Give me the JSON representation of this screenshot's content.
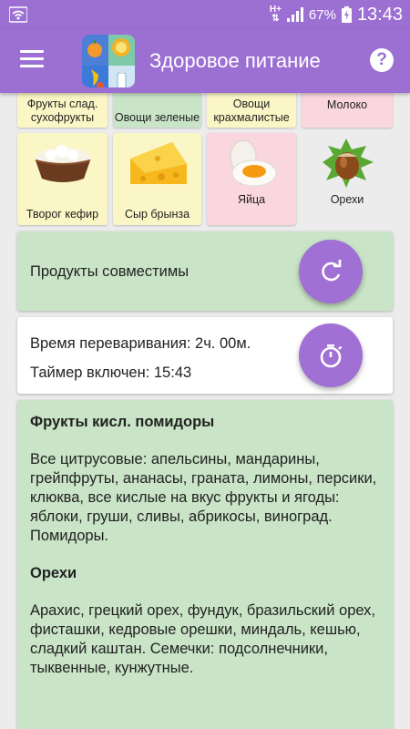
{
  "status_bar": {
    "network_type": "H+",
    "battery": "67%",
    "time": "13:43"
  },
  "app_bar": {
    "title": "Здоровое питание",
    "help_label": "?"
  },
  "categories_top": [
    {
      "label": "Фрукты слад. сухофрукты",
      "color": "#fbf6c5"
    },
    {
      "label": "Овощи зеленые",
      "color": "#c9e4c6"
    },
    {
      "label": "Овощи крахмалистые",
      "color": "#fbf6c5"
    },
    {
      "label": "Молоко",
      "color": "#fad6de"
    }
  ],
  "categories_bottom": [
    {
      "label": "Творог кефир",
      "icon": "cottage-cheese-icon",
      "color": "#fbf6c5"
    },
    {
      "label": "Сыр брынза",
      "icon": "cheese-icon",
      "color": "#fbf6c5"
    },
    {
      "label": "Яйца",
      "icon": "eggs-icon",
      "color": "#fad6de"
    },
    {
      "label": "Орехи",
      "icon": "hazelnut-icon",
      "color": "#ececec"
    }
  ],
  "compat_card": {
    "text": "Продукты совместимы",
    "button_icon": "refresh-icon"
  },
  "timer_card": {
    "digest_time": "Время переваривания: 2ч. 00м.",
    "timer_status": "Таймер включен: 15:43",
    "button_icon": "stopwatch-icon"
  },
  "info": {
    "section1_title": "Фрукты кисл. помидоры",
    "section1_body": "Все цитрусовые: апельсины, мандарины, грейпфруты, ананасы, граната, лимоны, персики, клюква, все кислые на вкус фрукты и ягоды: яблоки, груши, сливы, абрикосы, виноград. Помидоры.",
    "section2_title": "Орехи",
    "section2_body": "Арахис, грецкий орех, фундук, бразильский орех, фисташки, кедровые орешки, миндаль, кешью, сладкий каштан. Семечки: подсолнечники, тыквенные, кунжутные."
  },
  "colors": {
    "primary": "#9c6fd3",
    "fab": "#a070d4",
    "green_card": "#c9e4c6",
    "yellow_tile": "#fbf6c5",
    "pink_tile": "#fad6de"
  }
}
